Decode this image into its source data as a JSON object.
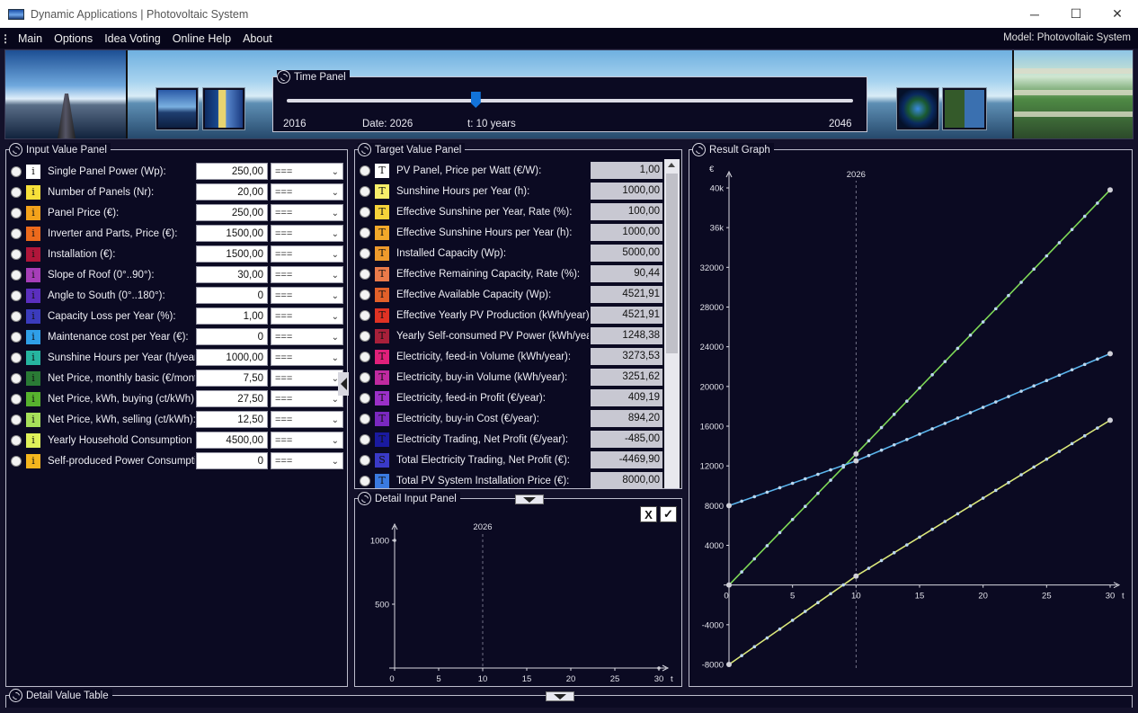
{
  "window": {
    "title": "Dynamic Applications | Photovoltaic System",
    "minimize": "─",
    "maximize": "☐",
    "close": "✕"
  },
  "menu": {
    "items": [
      "Main",
      "Options",
      "Idea Voting",
      "Online Help",
      "About"
    ],
    "model_label": "Model:  Photovoltaic System"
  },
  "time_panel": {
    "title": "Time Panel",
    "start": "2016",
    "end": "2046",
    "date_label": "Date:  2026",
    "t_label": "t: 10  years",
    "fraction": 0.333
  },
  "input_panel": {
    "title": "Input Value Panel",
    "rows": [
      {
        "badge": "i",
        "color": "#ffffff",
        "label": "Single Panel Power (Wp):",
        "value": "250,00",
        "select": "==="
      },
      {
        "badge": "i",
        "color": "#f7e03a",
        "label": "Number of Panels (Nr):",
        "value": "20,00",
        "select": "==="
      },
      {
        "badge": "i",
        "color": "#f3a21b",
        "label": "Panel Price (€):",
        "value": "250,00",
        "select": "==="
      },
      {
        "badge": "i",
        "color": "#ec6a1c",
        "label": "Inverter and Parts, Price (€):",
        "value": "1500,00",
        "select": "==="
      },
      {
        "badge": "i",
        "color": "#b0163a",
        "label": "Installation (€):",
        "value": "1500,00",
        "select": "==="
      },
      {
        "badge": "i",
        "color": "#a63eb8",
        "label": "Slope of Roof (0°..90°):",
        "value": "30,00",
        "select": "==="
      },
      {
        "badge": "i",
        "color": "#5b2fbf",
        "label": "Angle to South (0°..180°):",
        "value": "0",
        "select": "==="
      },
      {
        "badge": "i",
        "color": "#3b3bbd",
        "label": "Capacity Loss per Year (%):",
        "value": "1,00",
        "select": "==="
      },
      {
        "badge": "i",
        "color": "#2f9fe8",
        "label": "Maintenance cost per Year (€):",
        "value": "0",
        "select": "==="
      },
      {
        "badge": "i",
        "color": "#26b5a0",
        "label": "Sunshine Hours per Year (h/year):",
        "value": "1000,00",
        "select": "==="
      },
      {
        "badge": "i",
        "color": "#2a7a35",
        "label": "Net Price, monthly basic (€/month):",
        "value": "7,50",
        "select": "==="
      },
      {
        "badge": "i",
        "color": "#57b22e",
        "label": "Net Price, kWh, buying (ct/kWh):",
        "value": "27,50",
        "select": "==="
      },
      {
        "badge": "i",
        "color": "#a7e05a",
        "label": "Net Price, kWh, selling (ct/kWh):",
        "value": "12,50",
        "select": "==="
      },
      {
        "badge": "i",
        "color": "#dff05a",
        "label": "Yearly Household Consumption (kWh",
        "value": "4500,00",
        "select": "==="
      },
      {
        "badge": "i",
        "color": "#f4b51e",
        "label": "Self-produced Power Consumption (",
        "value": "0",
        "select": "==="
      }
    ]
  },
  "target_panel": {
    "title": "Target Value Panel",
    "rows": [
      {
        "badge": "T",
        "color": "#ffffff",
        "label": "PV Panel, Price per Watt (€/W):",
        "value": "1,00"
      },
      {
        "badge": "T",
        "color": "#f7ee6a",
        "label": "Sunshine Hours per Year (h):",
        "value": "1000,00"
      },
      {
        "badge": "T",
        "color": "#f6d33a",
        "label": "Effective Sunshine per Year, Rate (%):",
        "value": "100,00"
      },
      {
        "badge": "T",
        "color": "#f2a82a",
        "label": "Effective Sunshine Hours per Year (h):",
        "value": "1000,00"
      },
      {
        "badge": "T",
        "color": "#ee9a2c",
        "label": "Installed Capacity (Wp):",
        "value": "5000,00"
      },
      {
        "badge": "T",
        "color": "#ea7a4a",
        "label": "Effective Remaining Capacity, Rate (%):",
        "value": "90,44"
      },
      {
        "badge": "T",
        "color": "#e2602a",
        "label": "Effective Available Capacity (Wp):",
        "value": "4521,91"
      },
      {
        "badge": "T",
        "color": "#e03224",
        "label": "Effective Yearly PV Production (kWh/year):",
        "value": "4521,91"
      },
      {
        "badge": "T",
        "color": "#a8203a",
        "label": "Yearly Self-consumed PV Power (kWh/year):",
        "value": "1248,38"
      },
      {
        "badge": "T",
        "color": "#e0207a",
        "label": "Electricity, feed-in Volume (kWh/year):",
        "value": "3273,53"
      },
      {
        "badge": "T",
        "color": "#c02aa0",
        "label": "Electricity, buy-in Volume (kWh/year):",
        "value": "3251,62"
      },
      {
        "badge": "T",
        "color": "#9a30c8",
        "label": "Electricity, feed-in Profit (€/year):",
        "value": "409,19"
      },
      {
        "badge": "T",
        "color": "#7a28c0",
        "label": "Electricity, buy-in Cost (€/year):",
        "value": "894,20"
      },
      {
        "badge": "T",
        "color": "#1a1aa0",
        "label": "Electricity Trading, Net Profit (€/year):",
        "value": "-485,00"
      },
      {
        "badge": "S",
        "color": "#3a3ac8",
        "label": "Total Electricity Trading, Net Profit (€):",
        "value": "-4469,90"
      },
      {
        "badge": "T",
        "color": "#3a7ae0",
        "label": "Total PV System Installation Price (€):",
        "value": "8000,00"
      }
    ]
  },
  "detail_input_panel": {
    "title": "Detail Input Panel",
    "cancel_label": "X",
    "ok_label": "✓"
  },
  "result_graph": {
    "title": "Result Graph"
  },
  "detail_table": {
    "title": "Detail Value Table"
  },
  "icons": {
    "panel": "gear-icon",
    "collapse": "chevron-down-icon",
    "side": "chevron-left-icon"
  },
  "chart_data": [
    {
      "type": "line",
      "title": "",
      "ylabel": "€",
      "xlabel": "t",
      "marker_label": "2026",
      "marker_x": 10,
      "xlim": [
        0,
        30
      ],
      "ylim": [
        -8000,
        40000
      ],
      "x_ticks": [
        0,
        5,
        10,
        15,
        20,
        25,
        30
      ],
      "y_ticks": [
        -8000,
        -4000,
        0,
        4000,
        8000,
        12000,
        16000,
        20000,
        24000,
        28000,
        32000,
        36000,
        40000
      ],
      "y_tick_labels": [
        "-8000",
        "-4000",
        "0",
        "4000",
        "8000",
        "12000",
        "16000",
        "20000",
        "24000",
        "28000",
        "32000",
        "36k",
        "40k"
      ],
      "series": [
        {
          "color": "#7ed957",
          "x": [
            0,
            10,
            30
          ],
          "y": [
            0,
            13200,
            39800
          ]
        },
        {
          "color": "#5ab4ec",
          "x": [
            0,
            10,
            30
          ],
          "y": [
            8000,
            12500,
            23300
          ]
        },
        {
          "color": "#dbe87a",
          "x": [
            0,
            10,
            30
          ],
          "y": [
            -8000,
            900,
            16600
          ]
        }
      ]
    },
    {
      "type": "line",
      "title": "",
      "xlabel": "t",
      "marker_label": "2026",
      "marker_x": 10,
      "xlim": [
        0,
        30
      ],
      "ylim": [
        0,
        1000
      ],
      "x_ticks": [
        0,
        5,
        10,
        15,
        20,
        25,
        30
      ],
      "y_ticks": [
        0,
        500,
        1000
      ],
      "y_tick_labels": [
        "0",
        "500",
        "1000"
      ],
      "series": []
    }
  ],
  "colors": {
    "background": "#13112a",
    "panel": "#0b0a22",
    "accent": "#1273d9"
  }
}
